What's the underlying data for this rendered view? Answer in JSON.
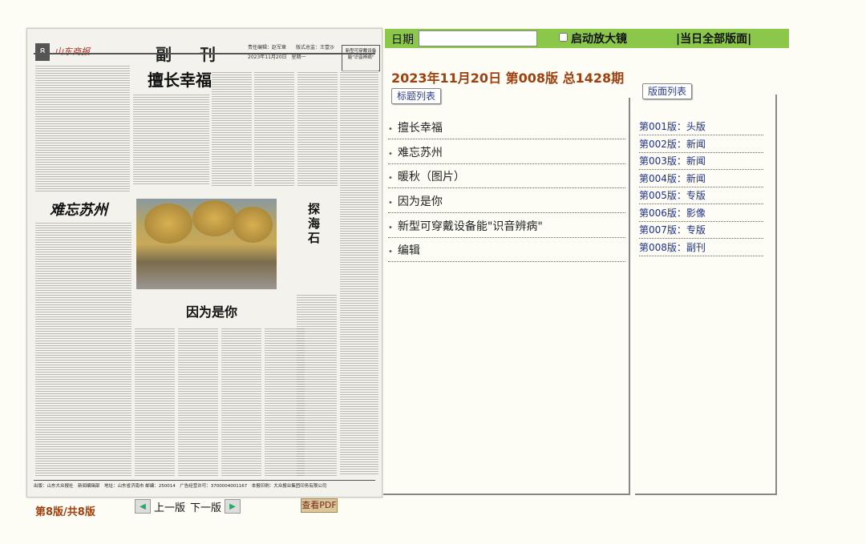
{
  "newspaper": {
    "masthead": "山东商报",
    "page_no": "8",
    "section": "副 刊",
    "meta1": "责任编辑：赵军章　　版式总监：王壹沙",
    "meta2": "2023年11月20日　星期一",
    "promo": "新型可穿戴设备能\"识音辨病\"",
    "headline1": "擅长幸福",
    "headline2": "难忘苏州",
    "headline3": "探海石",
    "headline4": "因为是你",
    "footer": "出版：山东大众报社　新闻编辑部　地址：山东省济南市 邮编：250014　广告经营许可：3700004001167　本报印刷：大众报业集团印务有限公司"
  },
  "pagination": {
    "info": "第8版/共8版",
    "prev": "上一版",
    "next": "下一版",
    "pdf": "查看PDF"
  },
  "toolbar": {
    "date_label": "日期",
    "date_value": "",
    "zoom_label": "启动放大镜",
    "all_pages": "|当日全部版面|"
  },
  "issue": "2023年11月20日 第008版 总1428期",
  "titles_tab": "标题列表",
  "titles": [
    "擅长幸福",
    "难忘苏州",
    "暖秋（图片）",
    "因为是你",
    "新型可穿戴设备能\"识音辨病\"",
    "编辑"
  ],
  "pages_tab": "版面列表",
  "pages": [
    "第001版：头版",
    "第002版：新闻",
    "第003版：新闻",
    "第004版：新闻",
    "第005版：专版",
    "第006版：影像",
    "第007版：专版",
    "第008版：副刊"
  ]
}
